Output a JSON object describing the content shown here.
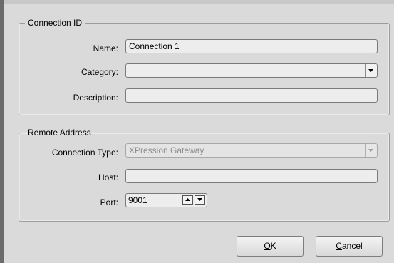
{
  "connection_id": {
    "legend": "Connection ID",
    "name_label": "Name:",
    "name_value": "Connection 1",
    "category_label": "Category:",
    "category_value": "",
    "description_label": "Description:",
    "description_value": ""
  },
  "remote_address": {
    "legend": "Remote Address",
    "connection_type_label": "Connection Type:",
    "connection_type_value": "XPression Gateway",
    "host_label": "Host:",
    "host_value": "",
    "port_label": "Port:",
    "port_value": "9001"
  },
  "buttons": {
    "ok_mnemonic": "O",
    "ok_rest": "K",
    "cancel_mnemonic": "C",
    "cancel_rest": "ancel"
  },
  "icons": {
    "combo_arrow": "chevron-down-icon",
    "spin_up": "arrow-up-icon",
    "spin_down": "arrow-down-icon"
  },
  "colors": {
    "dialog_bg": "#dadada",
    "backdrop": "#6b6b6b",
    "disabled_text": "#8e8e8e"
  }
}
